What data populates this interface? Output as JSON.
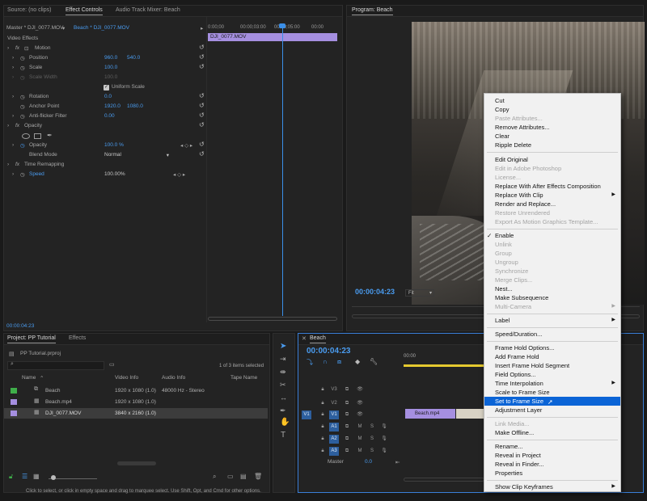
{
  "colors": {
    "accent": "#4a9cf0",
    "clip_purple": "#a58fe0",
    "highlight": "#0b64d6",
    "timecode_blue": "#4a9cf0"
  },
  "source_panel": {
    "tabs": [
      "Source: (no clips)",
      "Effect Controls",
      "Audio Track Mixer: Beach"
    ],
    "active_tab": "Effect Controls"
  },
  "effect_controls": {
    "master": "Master * DJI_0077.MOV",
    "clip": "Beach * DJI_0077.MOV",
    "ruler": {
      "t0": "0:00;00",
      "t1": "00:00;03:00",
      "t2": "00:00;05:00",
      "t3": "00:00"
    },
    "clip_bar": "DJI_0077.MOV",
    "section": "Video Effects",
    "motion": "Motion",
    "position_label": "Position",
    "position_x": "960.0",
    "position_y": "540.0",
    "scale_label": "Scale",
    "scale_value": "100.0",
    "scale_width_label": "Scale Width",
    "scale_width_value": "100.0",
    "uniform_scale": "Uniform Scale",
    "rotation_label": "Rotation",
    "rotation_value": "0.0",
    "anchor_label": "Anchor Point",
    "anchor_x": "1920.0",
    "anchor_y": "1080.0",
    "antiflicker_label": "Anti-flicker Filter",
    "antiflicker_value": "0.00",
    "opacity_section": "Opacity",
    "opacity_label": "Opacity",
    "opacity_value": "100.0 %",
    "blend_label": "Blend Mode",
    "blend_value": "Normal",
    "time_remap": "Time Remapping",
    "speed_label": "Speed",
    "speed_value": "100.00%",
    "current_time": "00:00:04:23"
  },
  "program": {
    "title": "Program: Beach",
    "timecode": "00:00:04:23",
    "fit": "Fit"
  },
  "project": {
    "tabs": [
      "Project: PP Tutorial",
      "Effects"
    ],
    "file": "PP Tutorial.prproj",
    "count": "1 of 3 items selected",
    "columns": [
      "Name",
      "Video Info",
      "Audio Info",
      "Tape Name"
    ],
    "items": [
      {
        "name": "Beach",
        "video": "1920 x 1080 (1.0)",
        "audio": "48000 Hz - Stereo",
        "color": "#3fae4a"
      },
      {
        "name": "Beach.mp4",
        "video": "1920 x 1080 (1.0)",
        "audio": "",
        "color": "#a58fe0"
      },
      {
        "name": "DJI_0077.MOV",
        "video": "3840 x 2160 (1.0)",
        "audio": "",
        "color": "#a58fe0"
      }
    ]
  },
  "timeline": {
    "tab": "Beach",
    "timecode": "00:00:04:23",
    "ruler_mark": "00:00",
    "tracks_video": [
      "V3",
      "V2",
      "V1"
    ],
    "tracks_audio": [
      "A1",
      "A2",
      "A3"
    ],
    "v1_src": "V1",
    "master": "Master",
    "master_value": "0.0",
    "clip1": "Beach.mp4"
  },
  "context_menu": {
    "items": [
      {
        "label": "Cut",
        "disabled": false
      },
      {
        "label": "Copy",
        "disabled": false
      },
      {
        "label": "Paste Attributes...",
        "disabled": true
      },
      {
        "label": "Remove Attributes...",
        "disabled": false
      },
      {
        "label": "Clear",
        "disabled": false
      },
      {
        "label": "Ripple Delete",
        "disabled": false
      },
      {
        "label": "Edit Original",
        "disabled": false
      },
      {
        "label": "Edit in Adobe Photoshop",
        "disabled": true
      },
      {
        "label": "License...",
        "disabled": true
      },
      {
        "label": "Replace With After Effects Composition",
        "disabled": false
      },
      {
        "label": "Replace With Clip",
        "disabled": false
      },
      {
        "label": "Render and Replace...",
        "disabled": false
      },
      {
        "label": "Restore Unrendered",
        "disabled": true
      },
      {
        "label": "Export As Motion Graphics Template...",
        "disabled": true
      },
      {
        "label": "Enable",
        "disabled": false
      },
      {
        "label": "Unlink",
        "disabled": true
      },
      {
        "label": "Group",
        "disabled": true
      },
      {
        "label": "Ungroup",
        "disabled": true
      },
      {
        "label": "Synchronize",
        "disabled": true
      },
      {
        "label": "Merge Clips...",
        "disabled": true
      },
      {
        "label": "Nest...",
        "disabled": false
      },
      {
        "label": "Make Subsequence",
        "disabled": false
      },
      {
        "label": "Multi-Camera",
        "disabled": true
      },
      {
        "label": "Label",
        "disabled": false
      },
      {
        "label": "Speed/Duration...",
        "disabled": false
      },
      {
        "label": "Frame Hold Options...",
        "disabled": false
      },
      {
        "label": "Add Frame Hold",
        "disabled": false
      },
      {
        "label": "Insert Frame Hold Segment",
        "disabled": false
      },
      {
        "label": "Field Options...",
        "disabled": false
      },
      {
        "label": "Time Interpolation",
        "disabled": false
      },
      {
        "label": "Scale to Frame Size",
        "disabled": false
      },
      {
        "label": "Set to Frame Size",
        "disabled": false
      },
      {
        "label": "Adjustment Layer",
        "disabled": false
      },
      {
        "label": "Link Media...",
        "disabled": true
      },
      {
        "label": "Make Offline...",
        "disabled": false
      },
      {
        "label": "Rename...",
        "disabled": false
      },
      {
        "label": "Reveal in Project",
        "disabled": false
      },
      {
        "label": "Reveal in Finder...",
        "disabled": false
      },
      {
        "label": "Properties",
        "disabled": false
      },
      {
        "label": "Show Clip Keyframes",
        "disabled": false
      }
    ]
  },
  "status_bar": "Click to select, or click in empty space and drag to marquee select. Use Shift, Opt, and Cmd for other options."
}
